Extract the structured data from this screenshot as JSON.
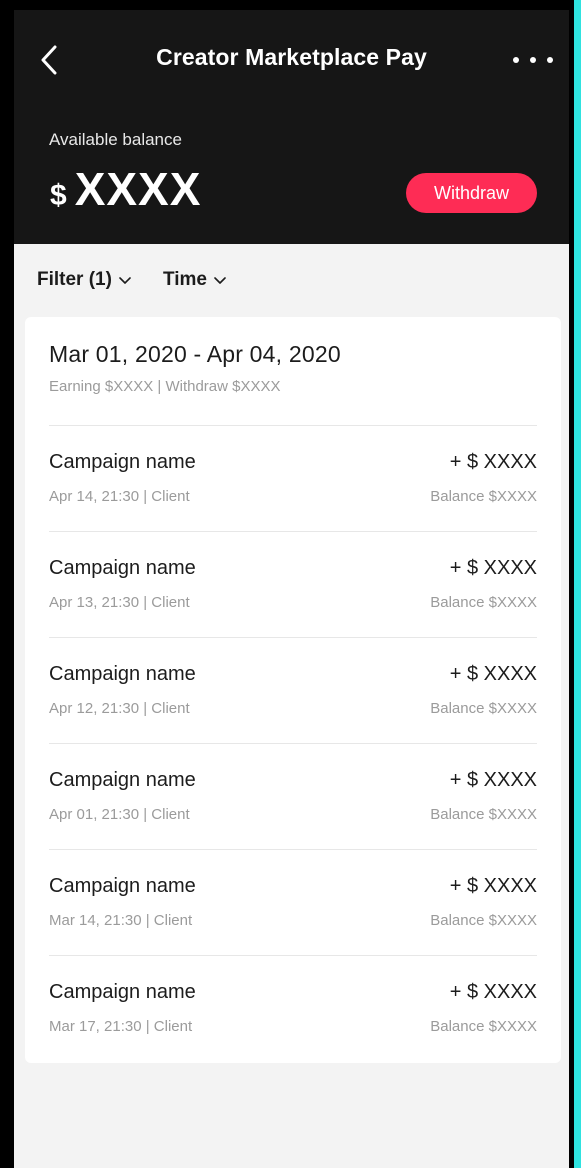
{
  "header": {
    "title": "Creator Marketplace Pay",
    "balance_label": "Available balance",
    "balance_currency": "$",
    "balance_value": "XXXX",
    "withdraw_label": "Withdraw"
  },
  "filters": [
    {
      "label": "Filter (1)"
    },
    {
      "label": "Time"
    }
  ],
  "period": {
    "range": "Mar 01, 2020 - Apr 04, 2020",
    "summary": "Earning $XXXX | Withdraw $XXXX"
  },
  "transactions": [
    {
      "name": "Campaign name",
      "meta": "Apr 14, 21:30 | Client",
      "amount": "+ $ XXXX",
      "balance": "Balance $XXXX"
    },
    {
      "name": "Campaign name",
      "meta": "Apr 13, 21:30 | Client",
      "amount": "+ $ XXXX",
      "balance": "Balance $XXXX"
    },
    {
      "name": "Campaign name",
      "meta": "Apr 12, 21:30 | Client",
      "amount": "+ $ XXXX",
      "balance": "Balance $XXXX"
    },
    {
      "name": "Campaign name",
      "meta": "Apr 01, 21:30 | Client",
      "amount": "+ $ XXXX",
      "balance": "Balance $XXXX"
    },
    {
      "name": "Campaign name",
      "meta": "Mar 14, 21:30 | Client",
      "amount": "+ $ XXXX",
      "balance": "Balance $XXXX"
    },
    {
      "name": "Campaign name",
      "meta": "Mar 17, 21:30 | Client",
      "amount": "+ $ XXXX",
      "balance": "Balance $XXXX"
    }
  ],
  "icons": {
    "back": "chevron-left-icon",
    "more": "more-horizontal-icon",
    "dropdown": "chevron-down-icon"
  },
  "colors": {
    "header_bg": "#161616",
    "accent": "#fe2c55",
    "page_bg": "#f3f3f3"
  }
}
